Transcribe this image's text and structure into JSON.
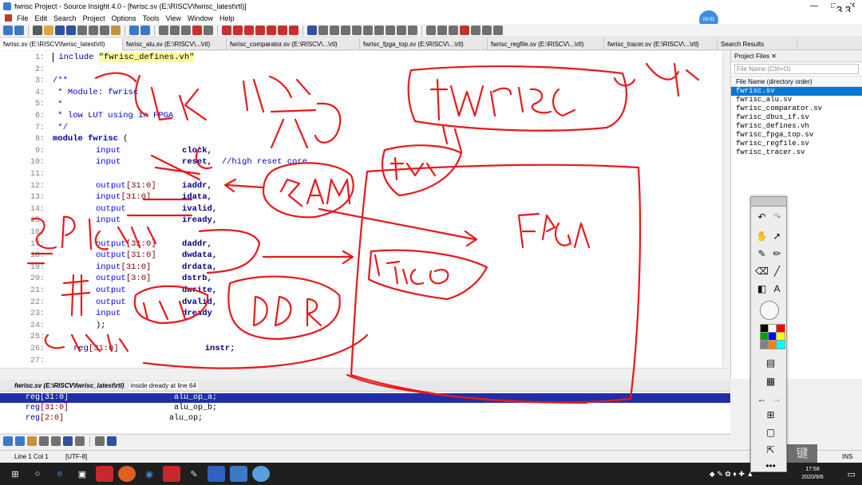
{
  "window": {
    "title": "fwrisc Project - Source Insight 4.0 - [fwrisc.sv (E:\\RISCV\\fwrisc_latest\\rtl)]",
    "controls": [
      "—",
      "□",
      "✕"
    ]
  },
  "menu": [
    "File",
    "Edit",
    "Search",
    "Project",
    "Options",
    "Tools",
    "View",
    "Window",
    "Help"
  ],
  "tabs": [
    {
      "label": "fwrisc.sv (E:\\RISCV\\fwrisc_latest\\rtl)",
      "active": true
    },
    {
      "label": "fwrisc_alu.sv (E:\\RISCV\\...\\rtl)",
      "active": false
    },
    {
      "label": "fwrisc_comparator.sv (E:\\RISCV\\...\\rtl)",
      "active": false
    },
    {
      "label": "fwrisc_fpga_top.sv (E:\\RISCV\\...\\rtl)",
      "active": false
    },
    {
      "label": "fwrisc_regfile.sv (E:\\RISCV\\...\\rtl)",
      "active": false
    },
    {
      "label": "fwrisc_tracer.sv (E:\\RISCV\\...\\rtl)",
      "active": false
    }
  ],
  "search_results_tab": "Search Results",
  "editor": {
    "line_numbers": [
      "1:",
      "2:",
      "3:",
      "4:",
      "5:",
      "6:",
      "7:",
      "8:",
      "9:",
      "10:",
      "11:",
      "12:",
      "13:",
      "14:",
      "15:",
      "16:",
      "17:",
      "18:",
      "19:",
      "20:",
      "21:",
      "22:",
      "23:",
      "24:",
      "25:",
      "26:",
      "27:"
    ],
    "include_kw": "include",
    "include_str": "\"fwrisc_defines.vh\"",
    "doc_open": "/**",
    "doc_module": " * Module: fwrisc",
    "doc_star": " *",
    "doc_desc": " * low LUT using in FPGA",
    "doc_close": " */",
    "module_kw": "module",
    "module_name": "fwrisc",
    "module_paren": " (",
    "ports": [
      {
        "dir": "input",
        "width": "",
        "name": "clock,",
        "comment": ""
      },
      {
        "dir": "input",
        "width": "",
        "name": "reset,",
        "comment": "//high reset core"
      },
      {
        "dir": "output",
        "width": "[31:0]",
        "name": "iaddr,",
        "comment": ""
      },
      {
        "dir": "input",
        "width": "[31:0]",
        "name": "idata,",
        "comment": ""
      },
      {
        "dir": "output",
        "width": "",
        "name": "ivalid,",
        "comment": ""
      },
      {
        "dir": "input",
        "width": "",
        "name": "iready,",
        "comment": ""
      },
      {
        "dir": "output",
        "width": "[31:0]",
        "name": "daddr,",
        "comment": ""
      },
      {
        "dir": "output",
        "width": "[31:0]",
        "name": "dwdata,",
        "comment": ""
      },
      {
        "dir": "input",
        "width": "[31:0]",
        "name": "drdata,",
        "comment": ""
      },
      {
        "dir": "output",
        "width": "[3:0]",
        "name": "dstrb,",
        "comment": ""
      },
      {
        "dir": "output",
        "width": "",
        "name": "dwrite,",
        "comment": ""
      },
      {
        "dir": "output",
        "width": "",
        "name": "dvalid,",
        "comment": ""
      },
      {
        "dir": "input",
        "width": "",
        "name": "dready",
        "comment": ""
      }
    ],
    "close_paren": ");",
    "reg_line": {
      "kw": "reg",
      "width": "[31:0]",
      "name": "instr;"
    }
  },
  "project_panel": {
    "title": "Project Files",
    "search_placeholder": "File Name (Ctrl+O)",
    "subheader": "File Name (directory order)",
    "files": [
      "fwrisc.sv",
      "fwrisc_alu.sv",
      "fwrisc_comparator.sv",
      "fwrisc_dbus_if.sv",
      "fwrisc_defines.vh",
      "fwrisc_fpga_top.sv",
      "fwrisc_regfile.sv",
      "fwrisc_tracer.sv"
    ],
    "selected_index": 0
  },
  "context": {
    "file": "fwrisc.sv (E:\\RISCV\\fwrisc_latest\\rtl)",
    "info": "inside dready at line 64",
    "lines": [
      {
        "kw": "reg",
        "width": "[31:0]",
        "name": "alu_op_a;",
        "selected": true
      },
      {
        "kw": "reg",
        "width": "[31:0]",
        "name": "alu_op_b;",
        "selected": false
      },
      {
        "kw": "reg",
        "width": "[2:0]",
        "name": "alu_op;",
        "selected": false
      }
    ]
  },
  "status": {
    "position": "Line 1  Col 1",
    "encoding": "[UTF-8]",
    "mode": "INS"
  },
  "page_indicator": "3 3",
  "recorder_badge": "00:02",
  "tray_overlay_text": "键",
  "clock": {
    "time": "17:58",
    "date": "2020/9/6"
  },
  "taskbar_icons": [
    "windows-start",
    "search",
    "edge",
    "store",
    "app-red",
    "firefox",
    "cortana",
    "flash",
    "pen",
    "finder",
    "wps",
    "browser"
  ],
  "palette_colors": [
    "#000000",
    "#ffffff",
    "#ff0000",
    "#00a000",
    "#0000ff",
    "#ffff00",
    "#808080",
    "#ff8000",
    "#00ffff"
  ],
  "accent": {
    "selection": "#1e2fa8",
    "ink": "#e8181c",
    "keyword": "#00008b"
  }
}
